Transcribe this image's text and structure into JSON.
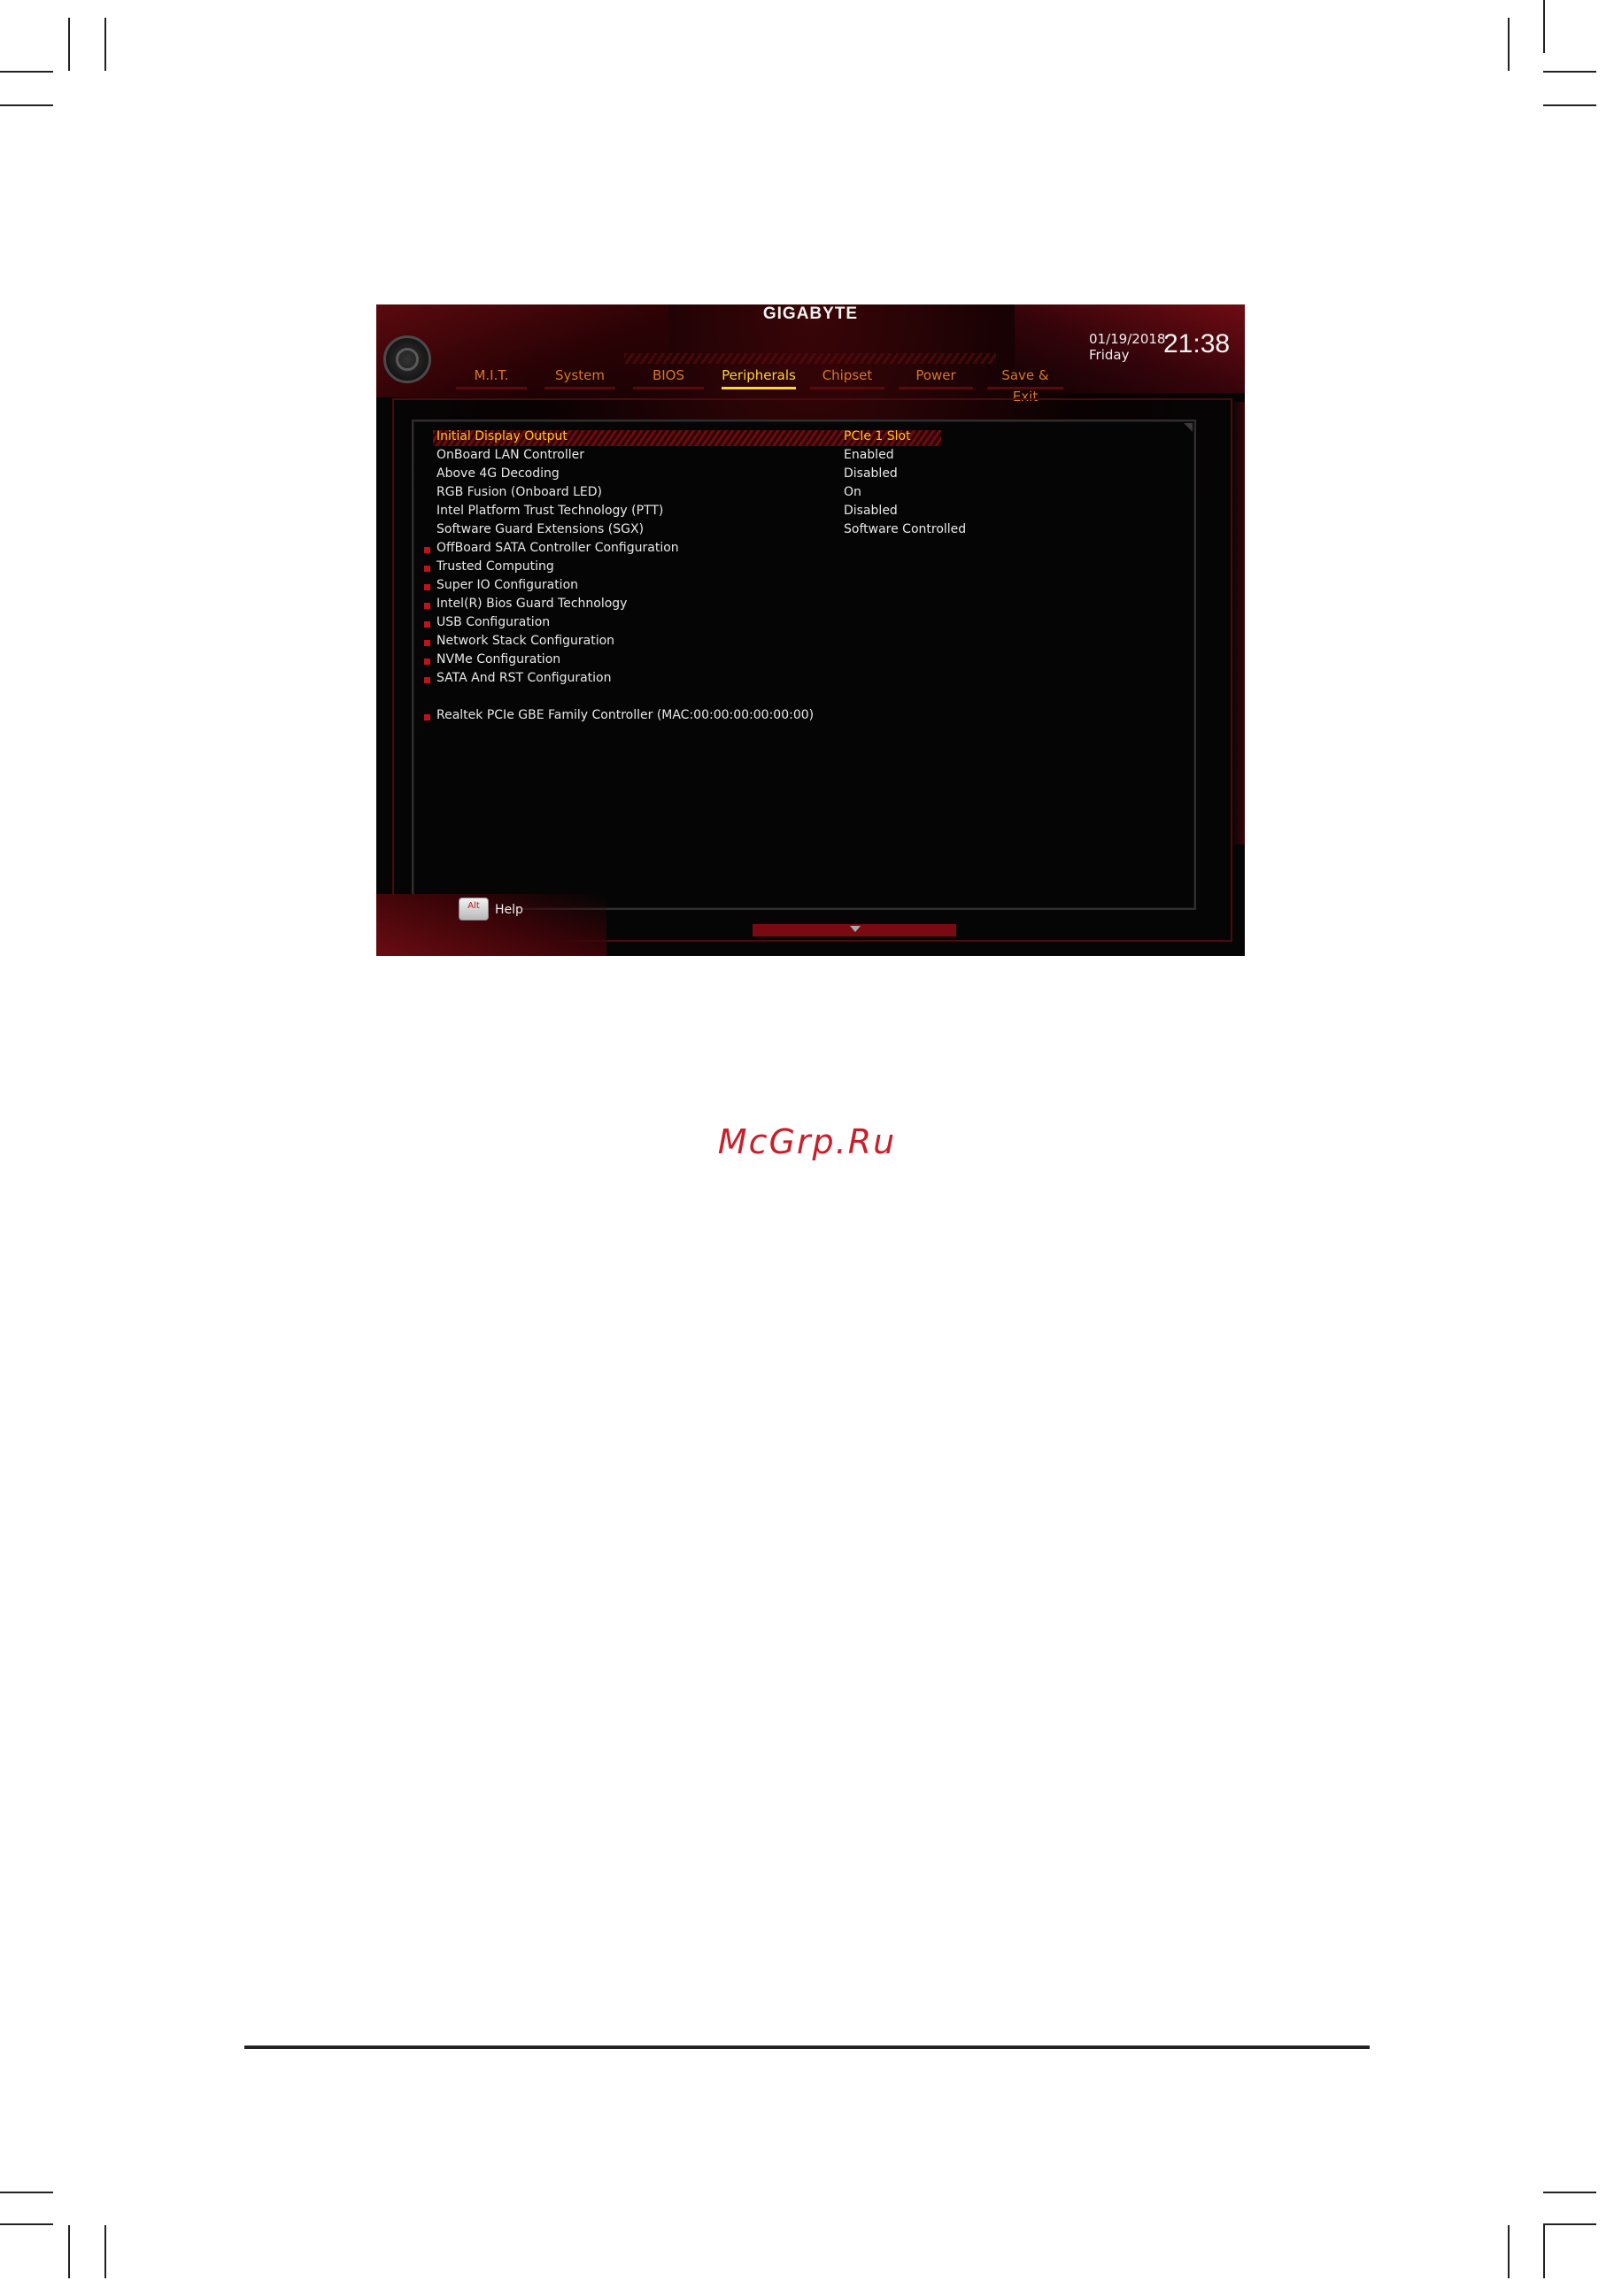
{
  "bios": {
    "brand": "GIGABYTE",
    "date": "01/19/2018",
    "day": "Friday",
    "time": "21:38",
    "tabs": [
      {
        "label": "M.I.T.",
        "active": false
      },
      {
        "label": "System",
        "active": false
      },
      {
        "label": "BIOS",
        "active": false
      },
      {
        "label": "Peripherals",
        "active": true
      },
      {
        "label": "Chipset",
        "active": false
      },
      {
        "label": "Power",
        "active": false
      },
      {
        "label": "Save & Exit",
        "active": false
      }
    ],
    "settings": [
      {
        "label": "Initial Display Output",
        "value": "PCIe 1 Slot"
      },
      {
        "label": "OnBoard LAN Controller",
        "value": "Enabled"
      },
      {
        "label": "Above 4G Decoding",
        "value": "Disabled"
      },
      {
        "label": "RGB Fusion (Onboard LED)",
        "value": "On"
      },
      {
        "label": "Intel Platform Trust Technology (PTT)",
        "value": "Disabled"
      },
      {
        "label": "Software Guard Extensions (SGX)",
        "value": "Software Controlled"
      }
    ],
    "submenus": [
      "OffBoard SATA Controller Configuration",
      "Trusted Computing",
      "Super IO Configuration",
      "Intel(R) Bios Guard Technology",
      "USB Configuration",
      "Network Stack Configuration",
      "NVMe Configuration",
      "SATA And RST Configuration"
    ],
    "extra_submenu": "Realtek PCIe GBE Family Controller (MAC:00:00:00:00:00:00)",
    "help_key": "Alt",
    "help_label": "Help",
    "accent_color": "#ffd23a",
    "brand_red": "#c0121a"
  },
  "watermark": "McGrp.Ru"
}
